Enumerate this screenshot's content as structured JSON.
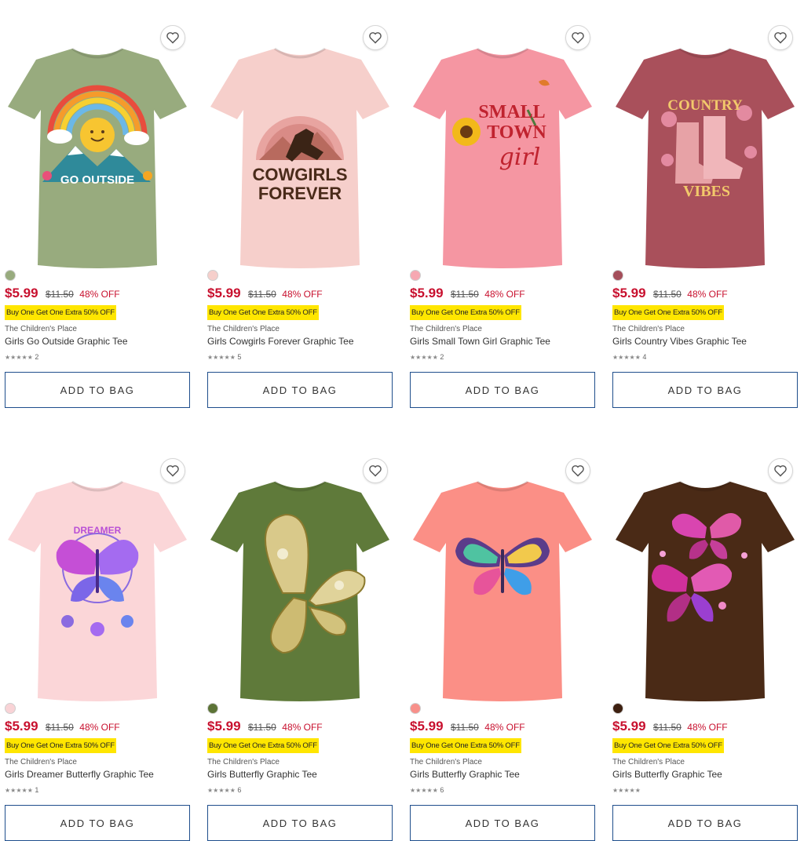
{
  "products": [
    {
      "shirt_color": "#98ab7e",
      "design": "go-outside",
      "swatch_color": "#98ab7e",
      "price": "$5.99",
      "original_price": "$11.50",
      "discount": "48% OFF",
      "promo": "Buy One Get One Extra 50% OFF",
      "brand": "The Children's Place",
      "name": "Girls Go Outside Graphic Tee",
      "stars": "★★★★★",
      "review_count": "2",
      "add_label": "ADD TO BAG",
      "design_text_1": "GO OUTSIDE"
    },
    {
      "shirt_color": "#f6cfcb",
      "design": "cowgirls",
      "swatch_color": "#f6cfcb",
      "price": "$5.99",
      "original_price": "$11.50",
      "discount": "48% OFF",
      "promo": "Buy One Get One Extra 50% OFF",
      "brand": "The Children's Place",
      "name": "Girls Cowgirls Forever Graphic Tee",
      "stars": "★★★★★",
      "review_count": "5",
      "add_label": "ADD TO BAG",
      "design_text_1": "COWGIRLS",
      "design_text_2": "FOREVER"
    },
    {
      "shirt_color": "#f596a2",
      "design": "small-town",
      "swatch_color": "#f6a8b2",
      "price": "$5.99",
      "original_price": "$11.50",
      "discount": "48% OFF",
      "promo": "Buy One Get One Extra 50% OFF",
      "brand": "The Children's Place",
      "name": "Girls Small Town Girl Graphic Tee",
      "stars": "★★★★★",
      "review_count": "2",
      "add_label": "ADD TO BAG",
      "design_text_1": "SMALL",
      "design_text_2": "TOWN",
      "design_text_3": "girl"
    },
    {
      "shirt_color": "#a9505b",
      "design": "country",
      "swatch_color": "#a44e5a",
      "price": "$5.99",
      "original_price": "$11.50",
      "discount": "48% OFF",
      "promo": "Buy One Get One Extra 50% OFF",
      "brand": "The Children's Place",
      "name": "Girls Country Vibes Graphic Tee",
      "stars": "★★★★★",
      "review_count": "4",
      "add_label": "ADD TO BAG",
      "design_text_1": "COUNTRY",
      "design_text_2": "VIBES"
    },
    {
      "shirt_color": "#fbd6d8",
      "design": "dreamer",
      "swatch_color": "#f9d3d6",
      "price": "$5.99",
      "original_price": "$11.50",
      "discount": "48% OFF",
      "promo": "Buy One Get One Extra 50% OFF",
      "brand": "The Children's Place",
      "name": "Girls Dreamer Butterfly Graphic Tee",
      "stars": "★★★★★",
      "review_count": "1",
      "add_label": "ADD TO BAG",
      "design_text_1": "DREAMER"
    },
    {
      "shirt_color": "#5f7a3a",
      "design": "butterfly-gold",
      "swatch_color": "#5c7336",
      "price": "$5.99",
      "original_price": "$11.50",
      "discount": "48% OFF",
      "promo": "Buy One Get One Extra 50% OFF",
      "brand": "The Children's Place",
      "name": "Girls Butterfly Graphic Tee",
      "stars": "★★★★★",
      "review_count": "6",
      "add_label": "ADD TO BAG"
    },
    {
      "shirt_color": "#fb8f86",
      "design": "butterfly-color",
      "swatch_color": "#f8908a",
      "price": "$5.99",
      "original_price": "$11.50",
      "discount": "48% OFF",
      "promo": "Buy One Get One Extra 50% OFF",
      "brand": "The Children's Place",
      "name": "Girls Butterfly Graphic Tee",
      "stars": "★★★★★",
      "review_count": "6",
      "add_label": "ADD TO BAG"
    },
    {
      "shirt_color": "#4a2a16",
      "design": "butterfly-pink",
      "swatch_color": "#3d2010",
      "price": "$5.99",
      "original_price": "$11.50",
      "discount": "48% OFF",
      "promo": "Buy One Get One Extra 50% OFF",
      "brand": "The Children's Place",
      "name": "Girls Butterfly Graphic Tee",
      "stars": "★★★★★",
      "review_count": "",
      "add_label": "ADD TO BAG"
    }
  ]
}
